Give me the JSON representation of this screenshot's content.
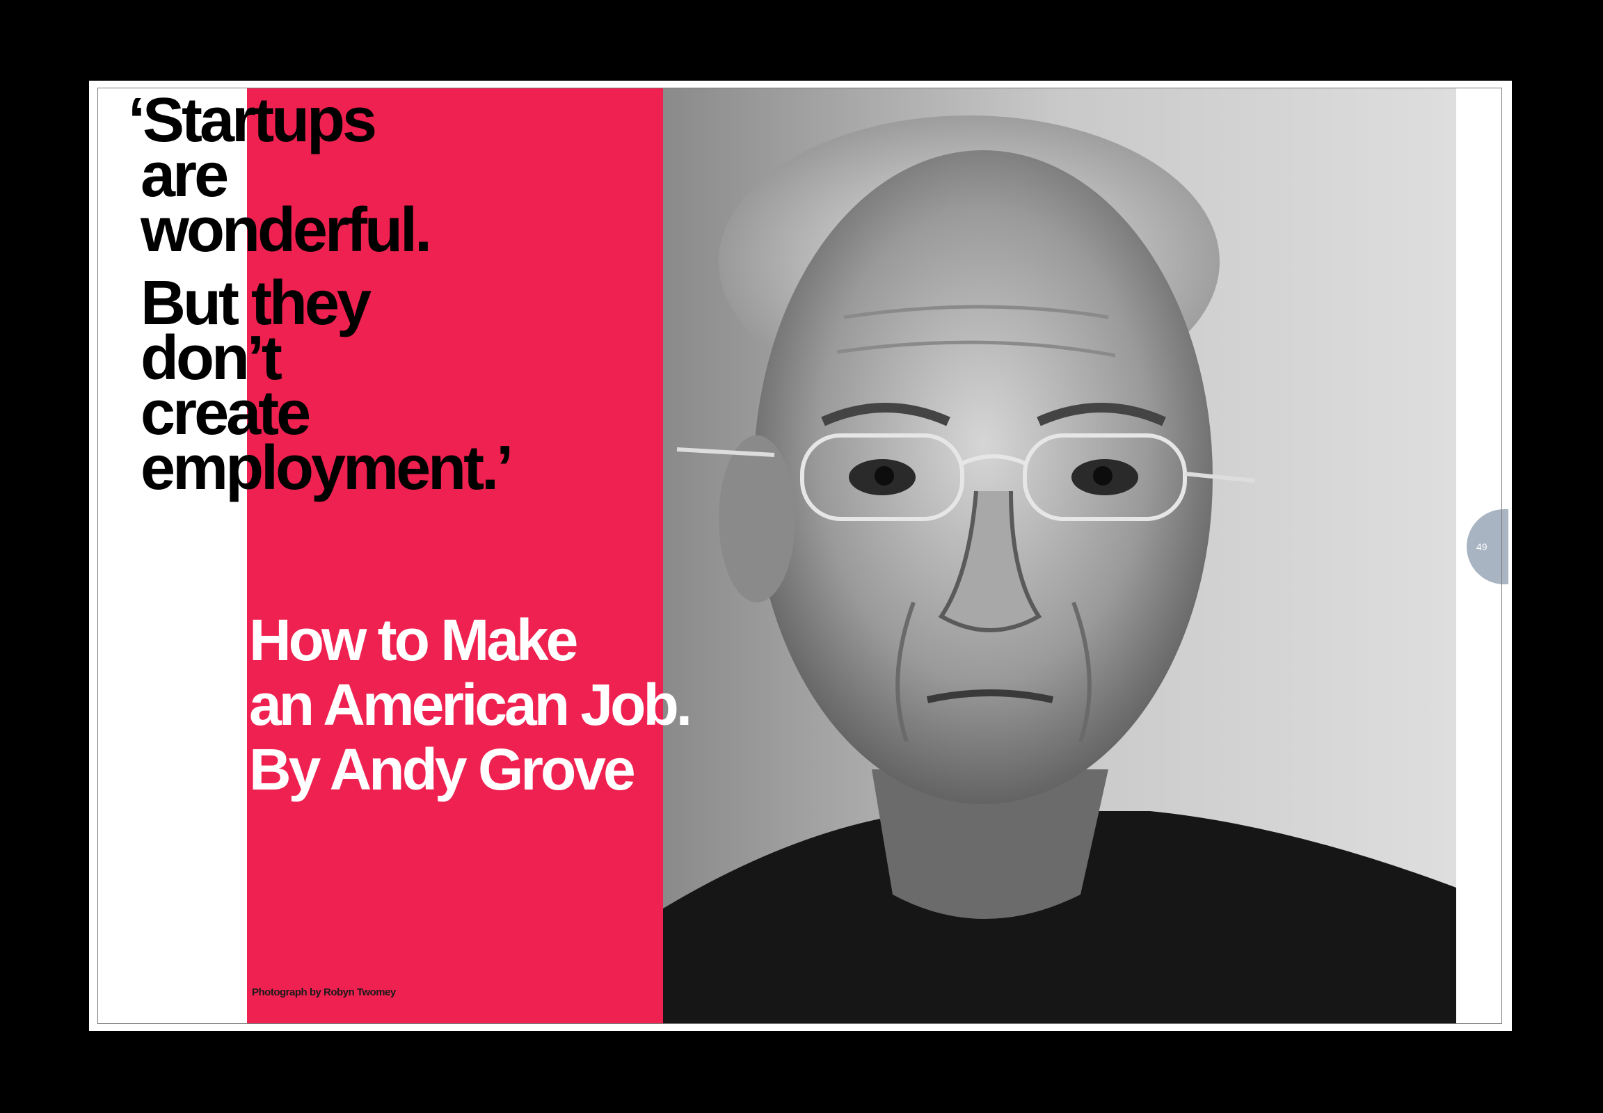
{
  "spread": {
    "pull_quote": {
      "lines": [
        "‘Startups",
        "are",
        "wonderful."
      ],
      "lines2": [
        "But they",
        "don’t",
        "create",
        "employment.’"
      ]
    },
    "headline": {
      "lines": [
        "How to Make",
        "an American Job.",
        "By Andy Grove"
      ]
    },
    "photo_credit": "Photograph by Robyn Twomey",
    "page_number": "49",
    "photo": {
      "subject": "black-and-white portrait of an older man with glasses",
      "accent_color": "#ef2150"
    }
  }
}
